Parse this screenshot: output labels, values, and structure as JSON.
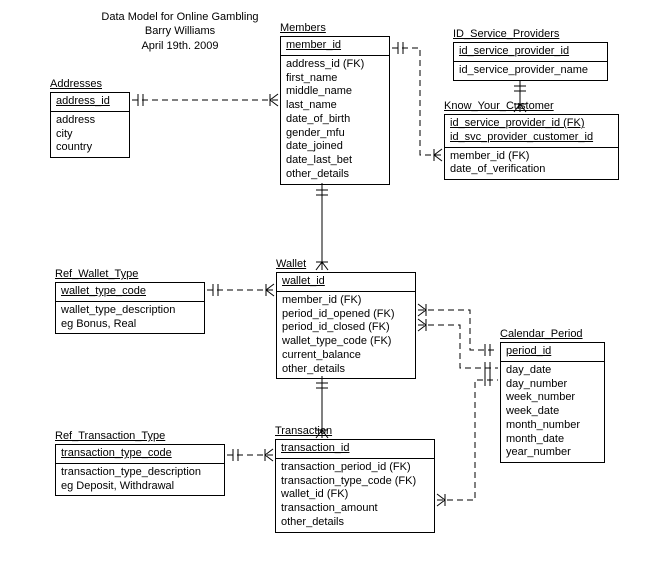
{
  "title": {
    "line1": "Data Model for Online Gambling",
    "line2": "Barry Williams",
    "line3": "April 19th. 2009"
  },
  "entities": {
    "addresses": {
      "name": "Addresses",
      "pk": "address_id",
      "fields": [
        "address",
        "city",
        "country"
      ]
    },
    "members": {
      "name": "Members",
      "pk": "member_id",
      "fields": [
        "address_id (FK)",
        "first_name",
        "middle_name",
        "last_name",
        "date_of_birth",
        "gender_mfu",
        "date_joined",
        "date_last_bet",
        "other_details"
      ]
    },
    "idsp": {
      "name": "ID_Service_Providers",
      "pk": "id_service_provider_id",
      "fields": [
        "id_service_provider_name"
      ]
    },
    "kyc": {
      "name": "Know_Your_Customer",
      "pk1": "id_service_provider_id (FK)",
      "pk2": "id_svc_provider_customer_id",
      "fields": [
        "member_id (FK)",
        "date_of_verification"
      ]
    },
    "refwt": {
      "name": "Ref_Wallet_Type",
      "pk": "wallet_type_code",
      "fields": [
        "wallet_type_description",
        "eg Bonus, Real"
      ]
    },
    "wallet": {
      "name": "Wallet",
      "pk": "wallet_id",
      "fields": [
        "member_id (FK)",
        "period_id_opened (FK)",
        "period_id_closed (FK)",
        "wallet_type_code (FK)",
        "current_balance",
        "other_details"
      ]
    },
    "calperiod": {
      "name": "Calendar_Period",
      "pk": "period_id",
      "fields": [
        "day_date",
        "day_number",
        "week_number",
        "week_date",
        "month_number",
        "month_date",
        "year_number"
      ]
    },
    "reftt": {
      "name": "Ref_Transaction_Type",
      "pk": "transaction_type_code",
      "fields": [
        "transaction_type_description",
        "eg Deposit, Withdrawal"
      ]
    },
    "transaction": {
      "name": "Transaction",
      "pk": "transaction_id",
      "fields": [
        "transaction_period_id (FK)",
        "transaction_type_code (FK)",
        "wallet_id (FK)",
        "transaction_amount",
        "other_details"
      ]
    }
  }
}
